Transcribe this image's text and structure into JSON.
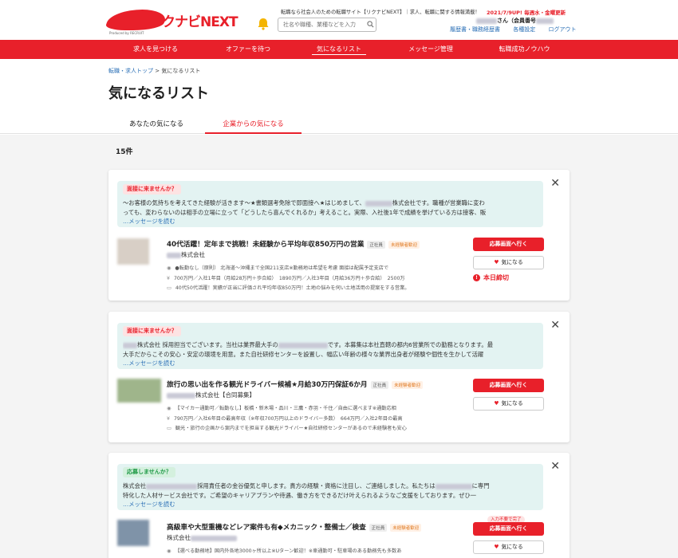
{
  "header": {
    "logo_text": "リクナビNEXT",
    "logo_sub": "Produced by RECRUIT",
    "tagline": "転職なら社会人のための転職サイト【リクナビNEXT】｜求人、転職に関する情報満載！",
    "promo": "2021/7/9UP! 毎週水・金曜更新",
    "search_placeholder": "社名や職種、業種などを入力",
    "user_suffix": "さん（会員番号",
    "links": [
      "履歴書・職務経歴書",
      "各種設定",
      "ログアウト"
    ]
  },
  "nav": [
    "求人を見つける",
    "オファーを待つ",
    "気になるリスト",
    "メッセージ管理",
    "転職成功ノウハウ"
  ],
  "breadcrumb": {
    "link": "転職・求人トップ",
    "sep": " > ",
    "current": "気になるリスト"
  },
  "page_title": "気になるリスト",
  "tabs": [
    "あなたの気になる",
    "企業からの気になる"
  ],
  "count": "15件",
  "colors": {
    "accent": "#e8202a",
    "link": "#2a6fb6",
    "msg_bg": "#e3f3f2"
  },
  "cards": [
    {
      "badge": "面接に来ませんか？",
      "msg_line1": "〜お客様の気持ちを考えてきた経験が活きます〜★書類選考免除で即面接へ★はじめまして、",
      "msg_line1b": "株式会社です。職種が営業職に変わ",
      "msg_line2": "っても、変わらないのは相手の立場に立って「どうしたら喜んでくれるか」考えること。実際、入社後1年で成績を挙げている方は接客、販",
      "msg_link": "…メッセージを読む",
      "job_title": "40代活躍！定年まで挑戦！未経験から平均年収850万円の営業",
      "chip1": "正社員",
      "chip2": "未経験者歓迎",
      "company": "株式会社",
      "d1": "●転勤なし（原則）  北海道〜沖縄まで全国211支店※勤務地は希望を考慮 面接は配属予定支店で",
      "d2": "700万円／入社1年目（月給28万円＋歩合給）　1890万円／入社3年目（月給36万円＋歩合給）　2500万",
      "d3": "40代50代活躍！実績が正当に評価され平均年収850万円！土地の悩みを伺い土地活用の提案をする営業。",
      "apply": "応募画面へ行く",
      "fav": "気になる",
      "deadline": "本日締切"
    },
    {
      "badge": "面接に来ませんか？",
      "msg_line1": "株式会社 採用担当でございます。当社は業界最大手の",
      "msg_line1b": "です。本募集は本社直轄の都内6営業所での勤務となります。最",
      "msg_line2": "大手だからこその安心・安定の環境を用意。また自社研修センターを設置し、幅広い年齢の様々な業界出身者が経験や個性を生かして活躍",
      "msg_link": "…メッセージを読む",
      "job_title": "旅行の思い出を作る観光ドライバー候補★月給30万円保証6か月",
      "chip1": "正社員",
      "chip2": "未経験者歓迎",
      "company": "株式会社【合同募集】",
      "d1": "【マイカー通勤可／転勤なし】板橋・新木場・品川・三鷹・赤羽・千住／自由に選べます※通勤応相",
      "d2": "790万円／入社6年目の最高年収（※年収700万円以上のドライバー多数）　664万円／入社2年目の最高",
      "d3": "観光・旅行の企画から案内までを担当する観光ドライバー★自社研修センターがあるので未経験者も安心",
      "apply": "応募画面へ行く",
      "fav": "気になる"
    },
    {
      "badge": "応募しませんか？",
      "msg_line1": "株式会社",
      "msg_line1b": "採用責任者の金谷優気と申します。貴方の経験・資格に注目し、ご連絡しました。私たちは",
      "msg_line1c": "に専門",
      "msg_line2": "特化した人材サービス会社です。ご希望のキャリアプランや待遇、働き方をできるだけ叶えられるようなご支援をしております。ぜひ一",
      "msg_link": "…メッセージを読む",
      "job_title": "高級車や大型重機などレア案件も有◆メカニック・整備士／検査",
      "chip1": "正社員",
      "chip2": "未経験者歓迎",
      "company": "株式会社",
      "d1": "【選べる勤務地】国内外各地3000ヶ所以上※Uターン歓迎！※車通勤可・駐車場のある勤務先も多数あ",
      "pill": "入力不要で完了",
      "apply": "応募画面へ行く",
      "fav": "気になる"
    }
  ]
}
